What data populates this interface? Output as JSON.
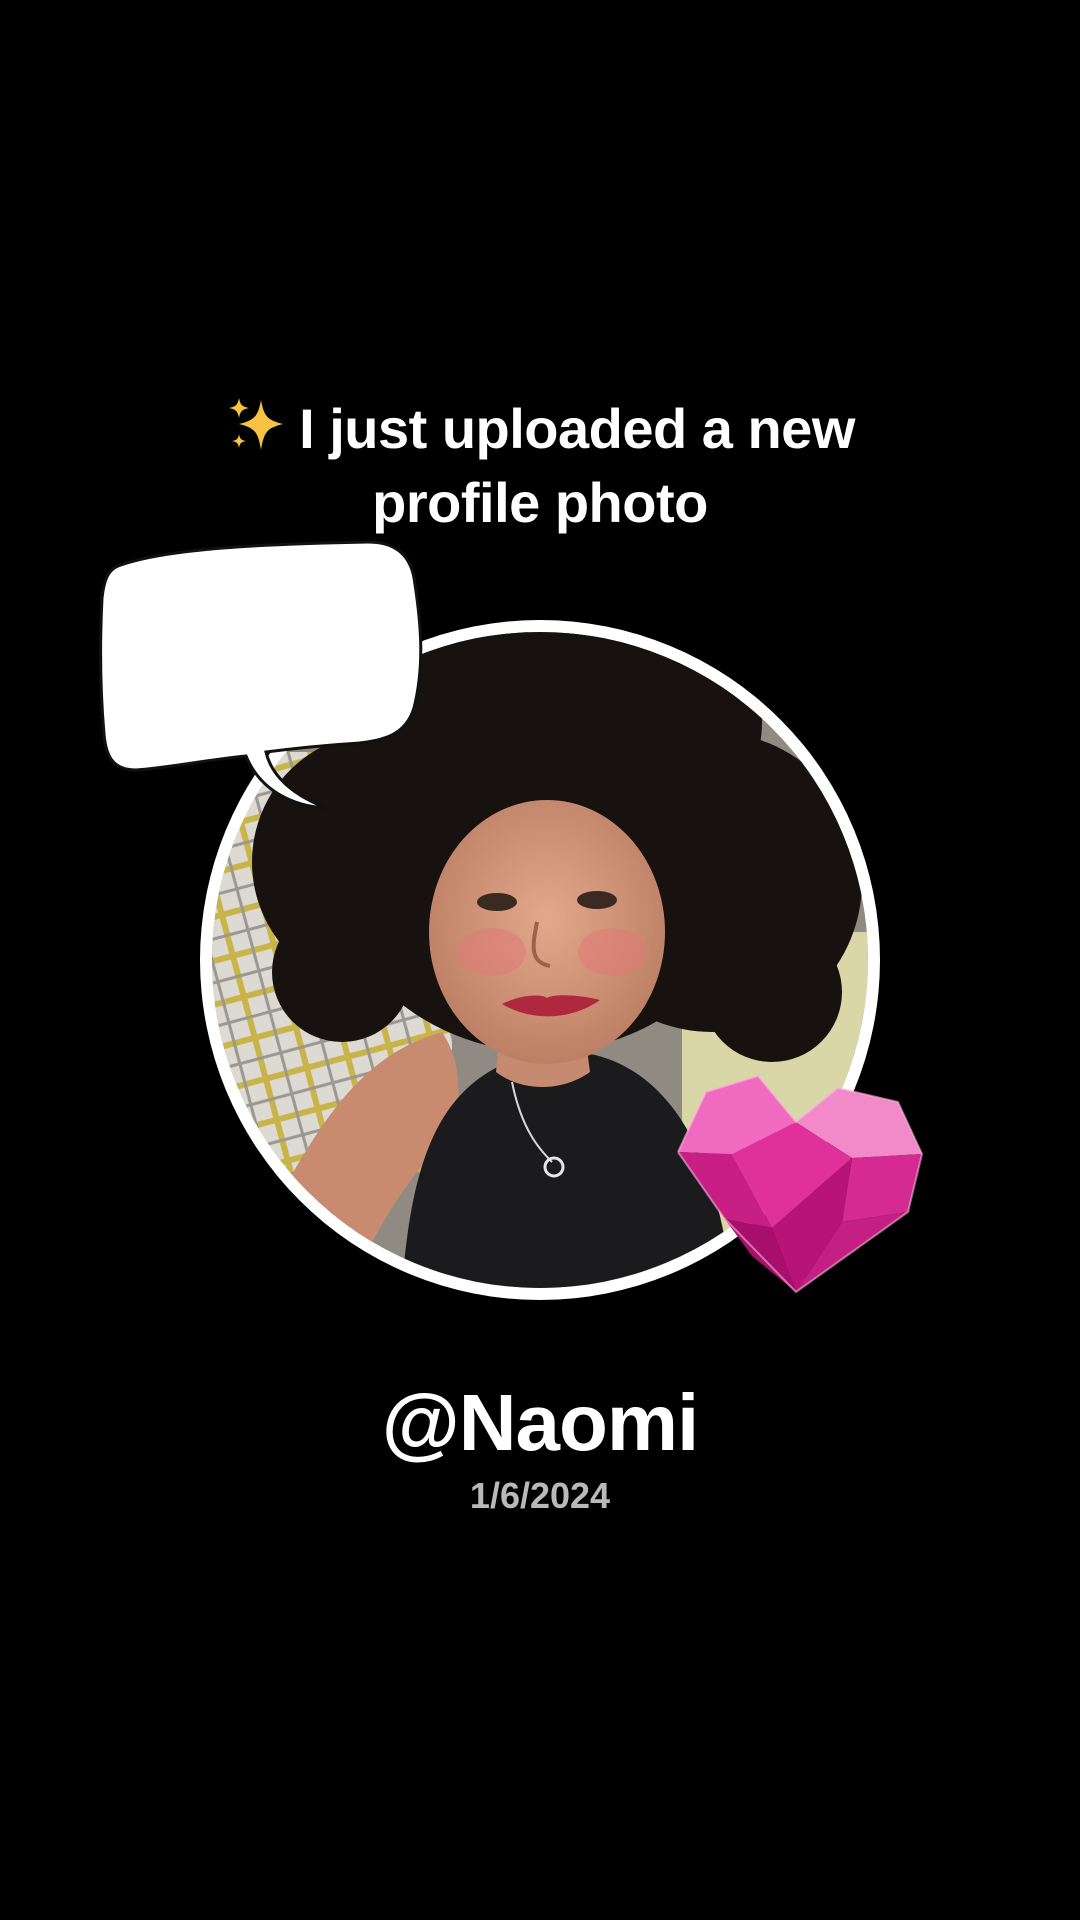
{
  "post": {
    "headline_line1": "I just uploaded a new",
    "headline_line2": "profile photo",
    "headline_emoji": "sparkles-icon",
    "username": "@Naomi",
    "date": "1/6/2024"
  },
  "stickers": {
    "speech_bubble": "speech-bubble-icon",
    "heart": "pink-gem-heart-icon"
  },
  "colors": {
    "background": "#000000",
    "text": "#ffffff",
    "date_text": "#b9b9b9",
    "heart_pink": "#e0309a"
  }
}
